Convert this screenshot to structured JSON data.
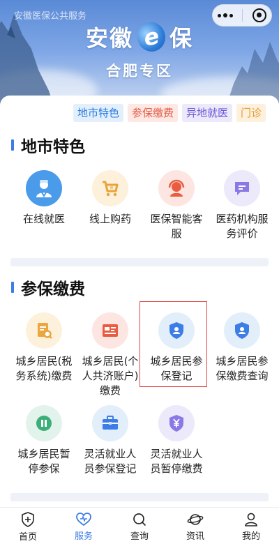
{
  "header": {
    "mini_program_name": "安徽医保公共服务",
    "logo_left": "安徽",
    "logo_e": "e",
    "logo_right": "保",
    "subtitle": "合肥专区"
  },
  "tabs": [
    {
      "label": "地市特色",
      "color": "blue"
    },
    {
      "label": "参保缴费",
      "color": "red"
    },
    {
      "label": "异地就医",
      "color": "purple"
    },
    {
      "label": "门诊",
      "color": "orange"
    }
  ],
  "sections": {
    "city": {
      "title": "地市特色",
      "items": [
        {
          "label": "在线就医",
          "icon": "doctor-icon",
          "bg": "#4a9be9"
        },
        {
          "label": "线上购药",
          "icon": "cart-icon",
          "bg": "#fdf1dc"
        },
        {
          "label": "医保智能客服",
          "icon": "headset-icon",
          "bg": "#fde6e2"
        },
        {
          "label": "医药机构服务评价",
          "icon": "message-icon",
          "bg": "#ece9fb"
        }
      ]
    },
    "insurance": {
      "title": "参保缴费",
      "items": [
        {
          "label": "城乡居民(税务系统)缴费",
          "icon": "document-search-icon",
          "bg": "#fdf1dc"
        },
        {
          "label": "城乡居民(个人共济账户) 缴费",
          "icon": "card-list-icon",
          "bg": "#fde6e2"
        },
        {
          "label": "城乡居民参保登记",
          "icon": "shield-user-icon",
          "bg": "#e3eefb"
        },
        {
          "label": "城乡居民参保缴费查询",
          "icon": "shield-user-icon",
          "bg": "#e3eefb"
        },
        {
          "label": "城乡居民暂停参保",
          "icon": "pause-icon",
          "bg": "#e2f3ec"
        },
        {
          "label": "灵活就业人员参保登记",
          "icon": "briefcase-icon",
          "bg": "#e3eefb"
        },
        {
          "label": "灵活就业人员暂停缴费",
          "icon": "yen-shield-icon",
          "bg": "#ece9fb"
        }
      ]
    }
  },
  "nav": [
    {
      "label": "首页",
      "icon": "shield-plus-icon",
      "active": false
    },
    {
      "label": "服务",
      "icon": "heart-icon",
      "active": true
    },
    {
      "label": "查询",
      "icon": "search-icon",
      "active": false
    },
    {
      "label": "资讯",
      "icon": "planet-icon",
      "active": false
    },
    {
      "label": "我的",
      "icon": "user-icon",
      "active": false
    }
  ]
}
